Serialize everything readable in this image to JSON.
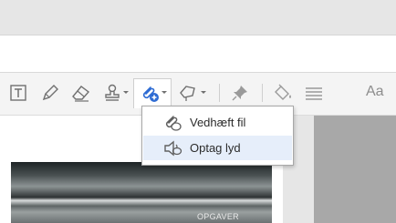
{
  "toolbar": {
    "tools": [
      {
        "name": "add-text-box",
        "icon": "text-box-icon"
      },
      {
        "name": "pencil",
        "icon": "pencil-icon"
      },
      {
        "name": "eraser",
        "icon": "eraser-icon"
      },
      {
        "name": "stamp",
        "icon": "stamp-icon"
      },
      {
        "name": "attach",
        "icon": "paperclip-plus-icon"
      },
      {
        "name": "draw-shapes",
        "icon": "shape-icon"
      },
      {
        "name": "pin",
        "icon": "pin-icon"
      },
      {
        "name": "fill-color",
        "icon": "paint-bucket-icon"
      },
      {
        "name": "line-style",
        "icon": "lines-icon"
      }
    ],
    "aa_label": "Aa"
  },
  "dropdown": {
    "items": [
      {
        "label": "Vedhæft fil",
        "icon": "paperclip-icon"
      },
      {
        "label": "Optag lyd",
        "icon": "speaker-icon"
      }
    ]
  },
  "document": {
    "image_label": "OPGAVER"
  },
  "colors": {
    "accent": "#2d6bd3",
    "icon_gray": "#707070",
    "menu_hover": "#e6eefa"
  }
}
